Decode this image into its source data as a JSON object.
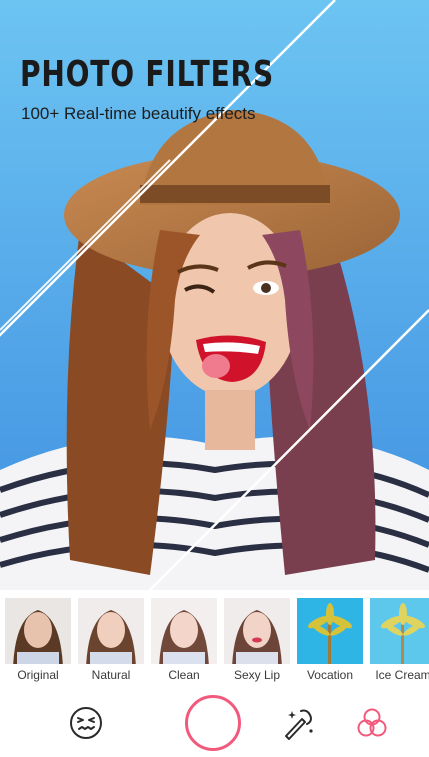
{
  "hero": {
    "title": "PHOTO FILTERS",
    "subtitle": "100+ Real-time beautify effects"
  },
  "filters": [
    {
      "label": "Original",
      "scene": "portrait",
      "tint": "#c9a58c"
    },
    {
      "label": "Natural",
      "scene": "portrait",
      "tint": "#d8b7a4"
    },
    {
      "label": "Clean",
      "scene": "portrait",
      "tint": "#ddc1b3"
    },
    {
      "label": "Sexy Lip",
      "scene": "portrait",
      "tint": "#e0bcb8"
    },
    {
      "label": "Vocation",
      "scene": "palm",
      "tint": "#30b6e8"
    },
    {
      "label": "Ice Cream",
      "scene": "palm",
      "tint": "#57c5ea"
    }
  ],
  "toolbar": {
    "items": [
      {
        "icon": "face-sticker-icon"
      },
      {
        "icon": "shutter-button"
      },
      {
        "icon": "magic-wand-icon"
      },
      {
        "icon": "filter-circles-icon"
      }
    ]
  },
  "colors": {
    "accent": "#f15a7c",
    "sky": "#6fc0f0"
  }
}
